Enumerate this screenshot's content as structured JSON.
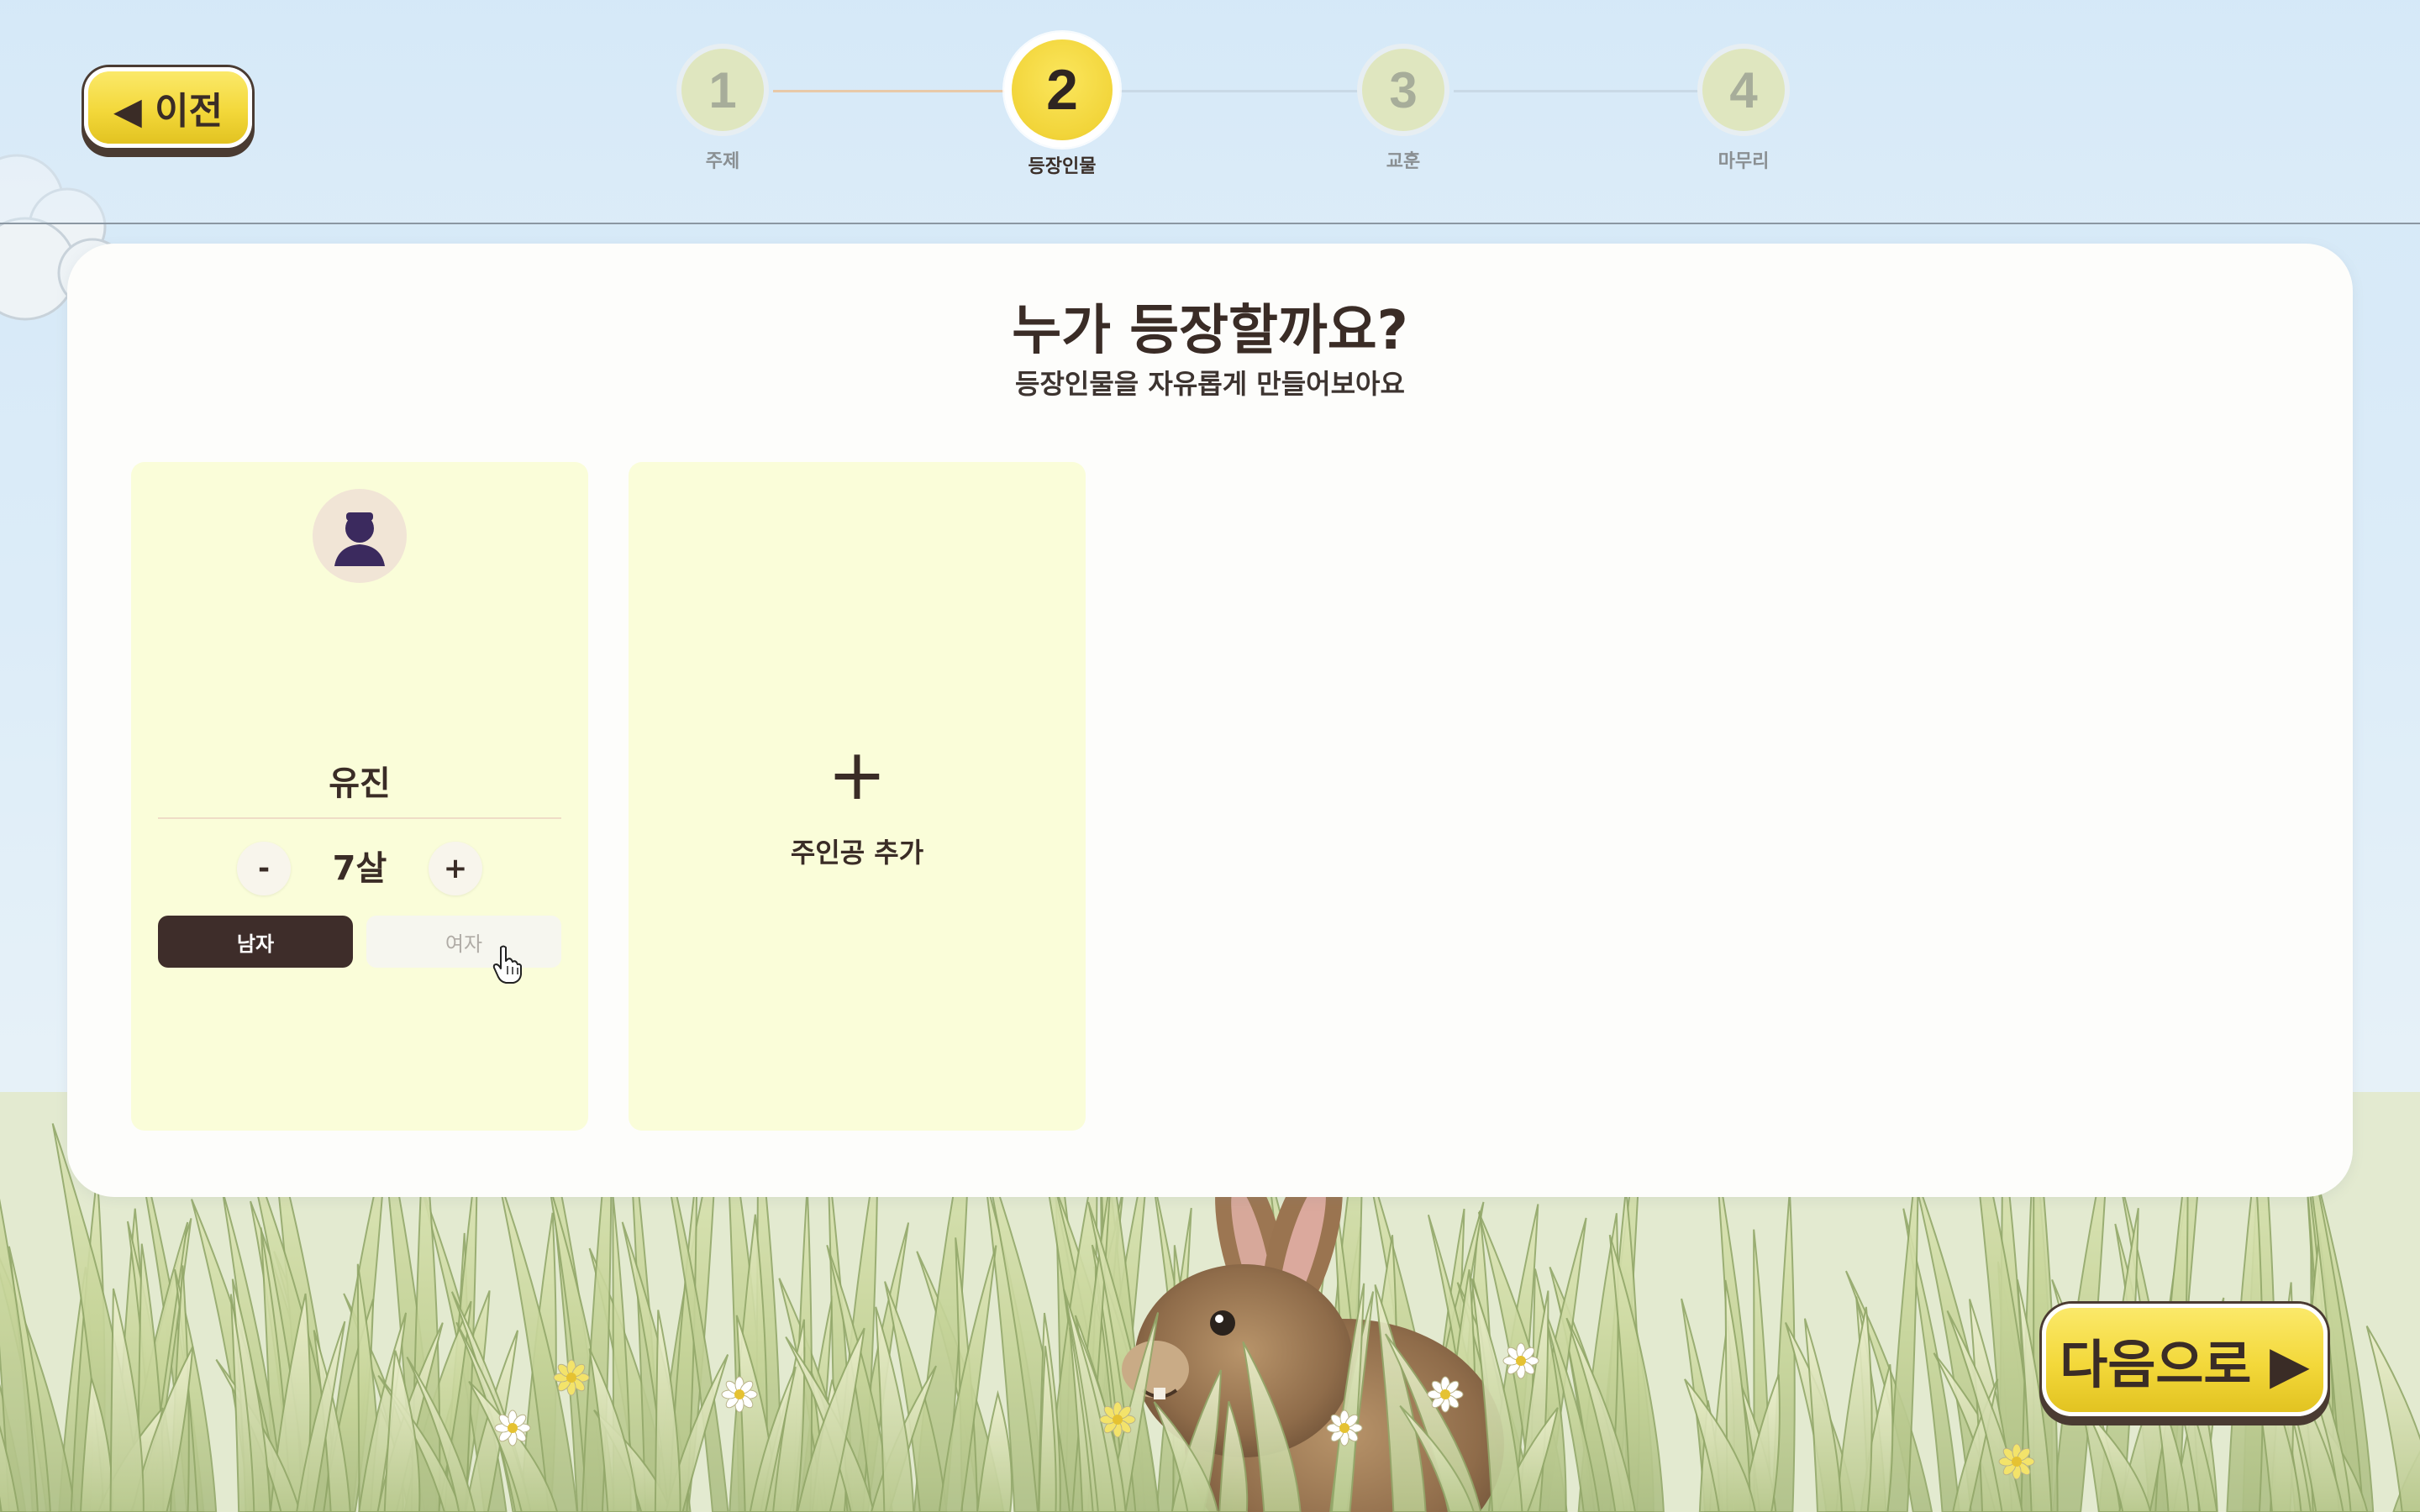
{
  "nav": {
    "prev_label": "◀ 이전",
    "next_label": "다음으로 ▶"
  },
  "steps": [
    {
      "number": "1",
      "label": "주제"
    },
    {
      "number": "2",
      "label": "등장인물"
    },
    {
      "number": "3",
      "label": "교훈"
    },
    {
      "number": "4",
      "label": "마무리"
    }
  ],
  "active_step": 2,
  "main": {
    "title": "누가 등장할까요?",
    "subtitle": "등장인물을 자유롭게 만들어보아요"
  },
  "character": {
    "name": "유진",
    "age": "7살",
    "minus_label": "-",
    "plus_label": "+",
    "gender_options": [
      "남자",
      "여자"
    ],
    "selected_gender": "남자"
  },
  "add_card": {
    "plus": "+",
    "label": "주인공 추가"
  },
  "colors": {
    "accent_yellow": "#f3d83a",
    "dark_brown": "#3e2d2a",
    "card_bg": "#fafdd9",
    "panel_bg": "#fdfdfb"
  }
}
